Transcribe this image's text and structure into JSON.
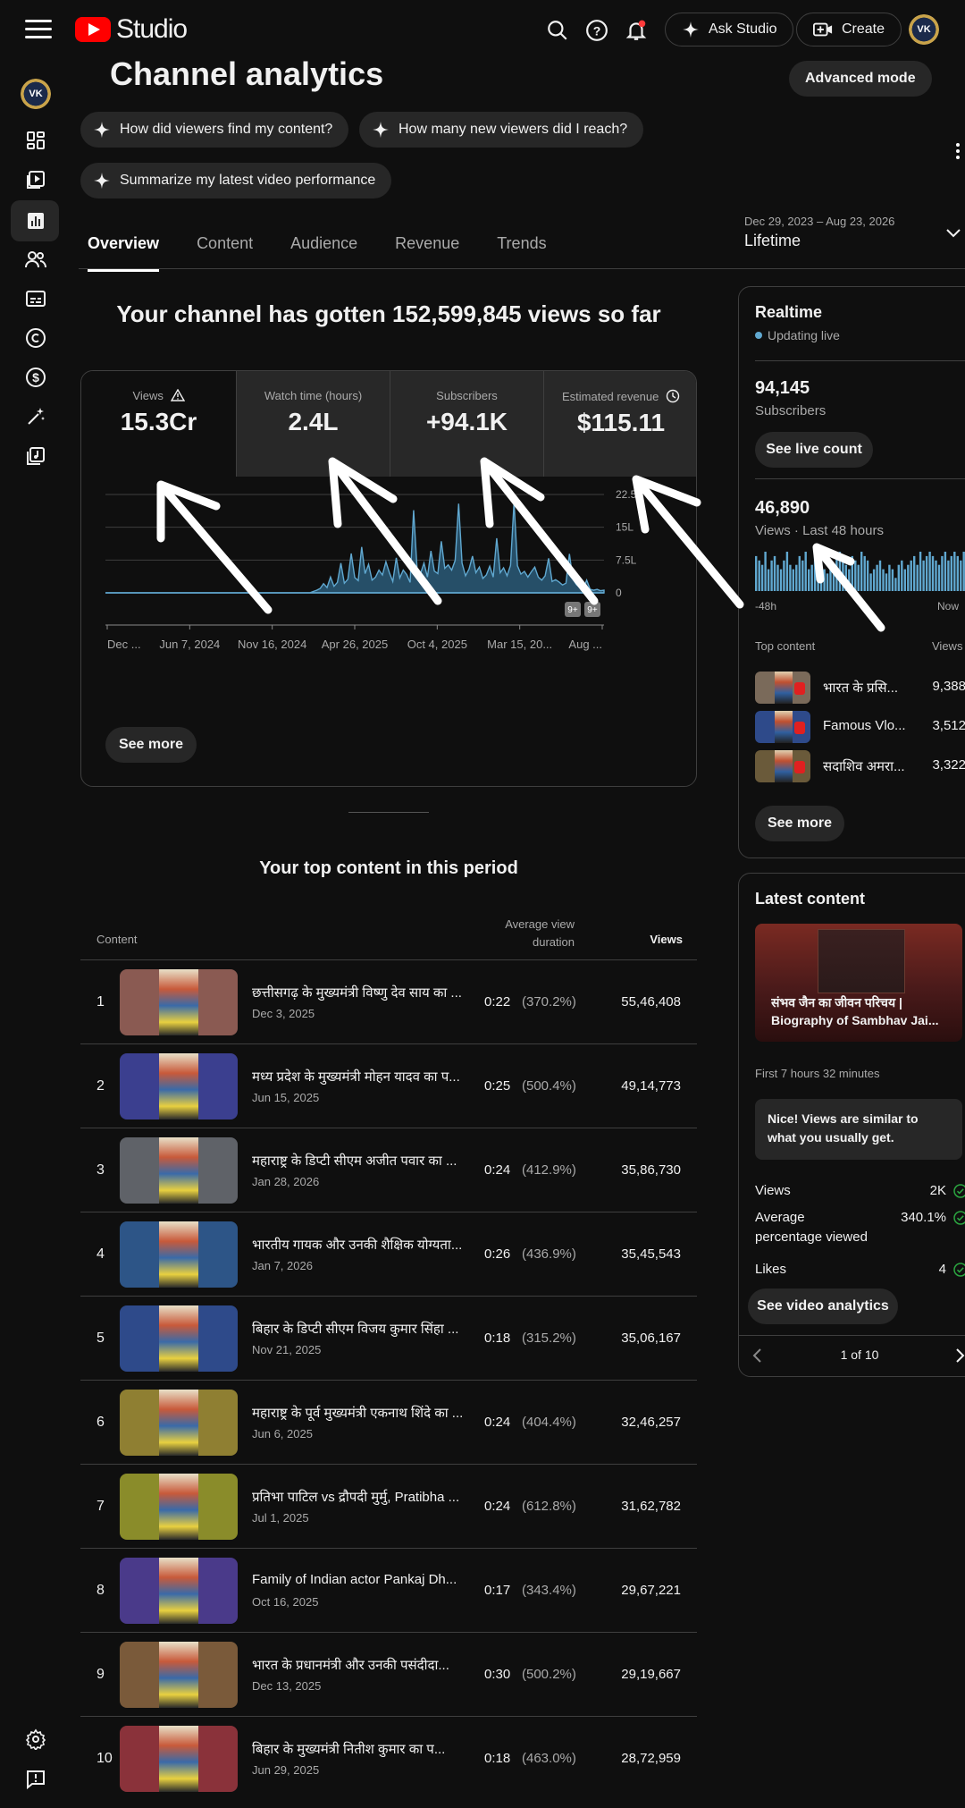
{
  "header": {
    "logo_text": "Studio",
    "ask_studio": "Ask Studio",
    "create": "Create",
    "avatar_text": "VK"
  },
  "page": {
    "title": "Channel analytics",
    "advanced_mode": "Advanced mode",
    "chips": [
      "How did viewers find my content?",
      "How many new viewers did I reach?",
      "Summarize my latest video performance"
    ],
    "tabs": [
      "Overview",
      "Content",
      "Audience",
      "Revenue",
      "Trends"
    ],
    "date_range": "Dec 29, 2023 – Aug 23, 2026",
    "date_label": "Lifetime",
    "headline": "Your channel has gotten 152,599,845 views so far"
  },
  "metrics": [
    {
      "label": "Views",
      "value": "15.3Cr"
    },
    {
      "label": "Watch time (hours)",
      "value": "2.4L"
    },
    {
      "label": "Subscribers",
      "value": "+94.1K"
    },
    {
      "label": "Estimated revenue",
      "value": "$115.11"
    }
  ],
  "chart_data": {
    "type": "area",
    "x_ticks": [
      "Dec ...",
      "Jun 7, 2024",
      "Nov 16, 2024",
      "Apr 26, 2025",
      "Oct 4, 2025",
      "Mar 15, 20...",
      "Aug ..."
    ],
    "y_ticks": [
      "22.5L",
      "15L",
      "7.5L",
      "0"
    ],
    "ylim": [
      0,
      22.5
    ],
    "color": "#60a8d0",
    "values": [
      0,
      0,
      0,
      0,
      0,
      0,
      0,
      0,
      0,
      0,
      0,
      0,
      0,
      0,
      0,
      0,
      0,
      0,
      0,
      0,
      0,
      0,
      0,
      0,
      0,
      0,
      0,
      0,
      0,
      0,
      0,
      0,
      0,
      0,
      0,
      0,
      0,
      0,
      0,
      0,
      0,
      0,
      0,
      0,
      0,
      0,
      0,
      0,
      0,
      0,
      0,
      0,
      0,
      0,
      0,
      0,
      0,
      0,
      0,
      0,
      0.3,
      0.6,
      1.0,
      2.1,
      1.2,
      3.6,
      1.5,
      2.4,
      6.8,
      2.2,
      3.1,
      9.0,
      3.5,
      2.8,
      10.5,
      4.4,
      6.5,
      2.9,
      3.6,
      5.2,
      4.1,
      7.1,
      4.6,
      2.6,
      8.0,
      3.4,
      5.2,
      4.2,
      2.4,
      18.9,
      5.4,
      4.4,
      6.8,
      3.6,
      9.6,
      5.0,
      4.4,
      11.8,
      5.6,
      6.4,
      5.2,
      7.4,
      20.4,
      6.8,
      3.9,
      5.4,
      8.4,
      4.6,
      5.9,
      3.3,
      4.1,
      6.1,
      3.6,
      12.5,
      4.6,
      5.7,
      3.9,
      6.3,
      20.8,
      6.2,
      4.3,
      4.9,
      3.6,
      4.8,
      5.9,
      3.6,
      2.9,
      3.9,
      7.9,
      2.6,
      3.0,
      2.5,
      1.8,
      2.2,
      8.9,
      3.2,
      1.9,
      1.2,
      0.9,
      2.9,
      0.8,
      0.6,
      0.8,
      0.5,
      0.6
    ],
    "badges": [
      "9+",
      "9+"
    ]
  },
  "see_more": "See more",
  "top_content": {
    "title": "Your top content in this period",
    "col_content": "Content",
    "col_avd_1": "Average view",
    "col_avd_2": "duration",
    "col_views": "Views",
    "rows": [
      {
        "num": "1",
        "title": "छत्तीसगढ़ के मुख्यमंत्री विष्णु देव साय का ...",
        "date": "Dec 3, 2025",
        "dur": "0:22",
        "pct": "(370.2%)",
        "views": "55,46,408",
        "color": "#8a5a52"
      },
      {
        "num": "2",
        "title": "मध्य प्रदेश के मुख्यमंत्री मोहन यादव का प...",
        "date": "Jun 15, 2025",
        "dur": "0:25",
        "pct": "(500.4%)",
        "views": "49,14,773",
        "color": "#3b3f8f"
      },
      {
        "num": "3",
        "title": "महाराष्ट्र के डिप्टी सीएम अजीत पवार का ...",
        "date": "Jan 28, 2026",
        "dur": "0:24",
        "pct": "(412.9%)",
        "views": "35,86,730",
        "color": "#5f6268"
      },
      {
        "num": "4",
        "title": "भारतीय गायक और उनकी शैक्षिक योग्यता...",
        "date": "Jan 7, 2026",
        "dur": "0:26",
        "pct": "(436.9%)",
        "views": "35,45,543",
        "color": "#2d5587"
      },
      {
        "num": "5",
        "title": "बिहार के डिप्टी सीएम विजय कुमार सिंहा ...",
        "date": "Nov 21, 2025",
        "dur": "0:18",
        "pct": "(315.2%)",
        "views": "35,06,167",
        "color": "#2e4a8a"
      },
      {
        "num": "6",
        "title": "महाराष्ट्र के पूर्व मुख्यमंत्री एकनाथ शिंदे का ...",
        "date": "Jun 6, 2025",
        "dur": "0:24",
        "pct": "(404.4%)",
        "views": "32,46,257",
        "color": "#8f7f32"
      },
      {
        "num": "7",
        "title": "प्रतिभा पाटिल vs द्रौपदी मुर्मु, Pratibha ...",
        "date": "Jul 1, 2025",
        "dur": "0:24",
        "pct": "(612.8%)",
        "views": "31,62,782",
        "color": "#8a8c2a"
      },
      {
        "num": "8",
        "title": "Family of Indian actor Pankaj Dh...",
        "date": "Oct 16, 2025",
        "dur": "0:17",
        "pct": "(343.4%)",
        "views": "29,67,221",
        "color": "#4a3a8a"
      },
      {
        "num": "9",
        "title": "भारत के प्रधानमंत्री और उनकी पसंदीदा...",
        "date": "Dec 13, 2025",
        "dur": "0:30",
        "pct": "(500.2%)",
        "views": "29,19,667",
        "color": "#7a5a3a"
      },
      {
        "num": "10",
        "title": "बिहार के मुख्यमंत्री नितीश कुमार का प...",
        "date": "Jun 29, 2025",
        "dur": "0:18",
        "pct": "(463.0%)",
        "views": "28,72,959",
        "color": "#8a323a"
      }
    ]
  },
  "realtime": {
    "title": "Realtime",
    "status": "Updating live",
    "subs_value": "94,145",
    "subs_label": "Subscribers",
    "see_live": "See live count",
    "views_value": "46,890",
    "views_label": "Views · Last 48 hours",
    "bars": [
      8,
      7,
      6,
      9,
      5,
      7,
      8,
      6,
      5,
      7,
      9,
      6,
      5,
      6,
      8,
      7,
      9,
      5,
      6,
      8,
      7,
      6,
      5,
      4,
      7,
      6,
      8,
      9,
      7,
      6,
      5,
      8,
      7,
      6,
      9,
      8,
      7,
      4,
      5,
      6,
      7,
      5,
      4,
      6,
      5,
      3,
      6,
      7,
      5,
      6,
      7,
      8,
      6,
      9,
      7,
      8,
      9,
      8,
      7,
      6,
      8,
      9,
      7,
      8,
      9,
      8,
      7,
      9
    ],
    "axis_left": "-48h",
    "axis_right": "Now",
    "top_content_label": "Top content",
    "views_col": "Views",
    "items": [
      {
        "title": "भारत के प्रसि...",
        "views": "9,388",
        "color": "#7a6a5a"
      },
      {
        "title": "Famous Vlo...",
        "views": "3,512",
        "color": "#2e4a8a"
      },
      {
        "title": "सदाशिव अमरा...",
        "views": "3,322",
        "color": "#6a5a3a"
      }
    ],
    "see_more": "See more"
  },
  "latest": {
    "title": "Latest content",
    "video_title": "संभव जैन का जीवन परिचय | Biography of Sambhav Jai...",
    "first_time": "First 7 hours 32 minutes",
    "note": "Nice! Views are similar to what you usually get.",
    "stats": [
      {
        "label": "Views",
        "value": "2K"
      },
      {
        "label": "Average percentage viewed",
        "value": "340.1%"
      },
      {
        "label": "Likes",
        "value": "4"
      }
    ],
    "see_analytics": "See video analytics",
    "pager": "1 of 10"
  }
}
